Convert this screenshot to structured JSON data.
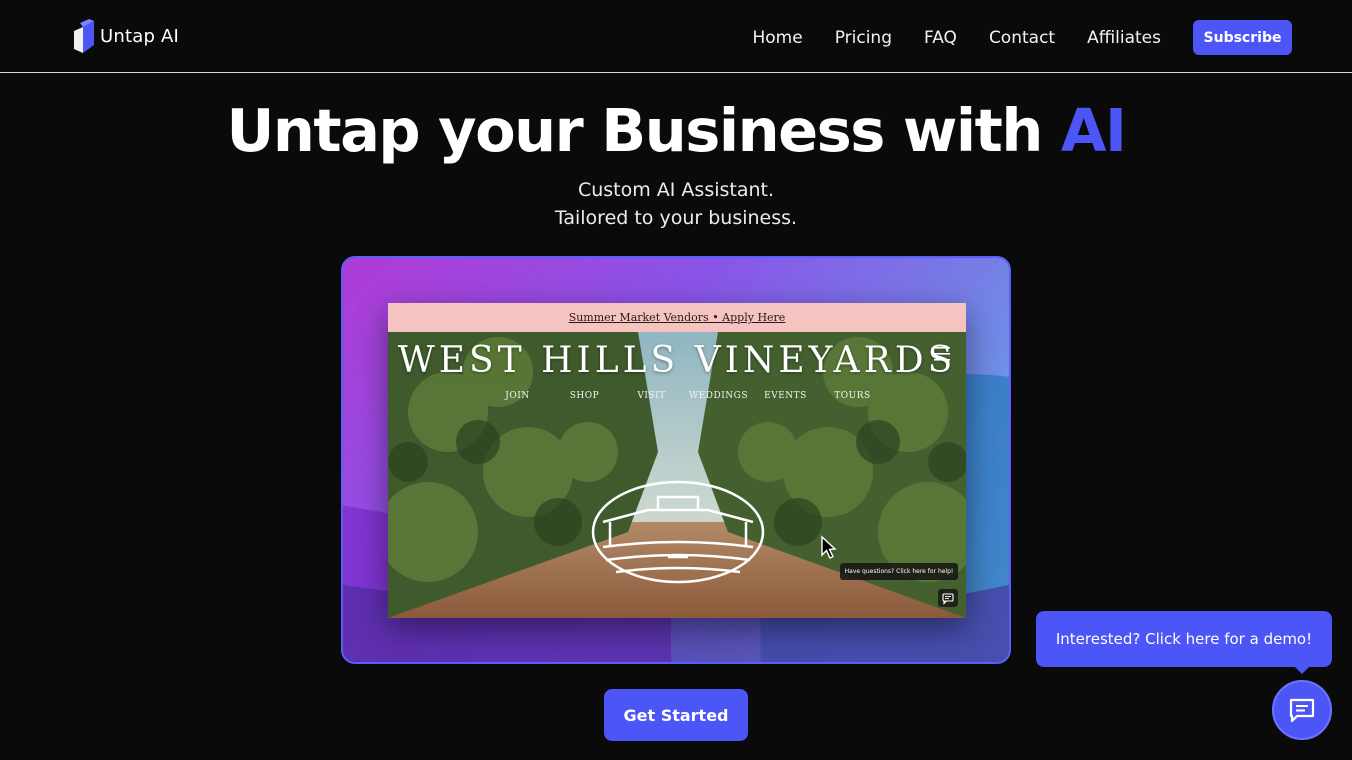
{
  "nav": {
    "brand": "Untap AI",
    "links": [
      "Home",
      "Pricing",
      "FAQ",
      "Contact",
      "Affiliates"
    ],
    "subscribe": "Subscribe"
  },
  "hero": {
    "title_main": "Untap your Business with ",
    "title_accent": "AI",
    "subtitle_line1": "Custom AI Assistant.",
    "subtitle_line2": "Tailored to your business."
  },
  "preview": {
    "announcement": "Summer Market Vendors • Apply Here",
    "site_title": "WEST HILLS VINEYARDS",
    "site_nav": [
      "JOIN",
      "SHOP",
      "VISIT",
      "WEDDINGS",
      "EVENTS",
      "TOURS"
    ],
    "chat_tooltip": "Have questions? Click here for help!"
  },
  "cta": {
    "label": "Get Started"
  },
  "chat_widget": {
    "bubble": "Interested? Click here for a demo!"
  },
  "colors": {
    "accent": "#4c55f5",
    "background": "#0a0a0a"
  }
}
